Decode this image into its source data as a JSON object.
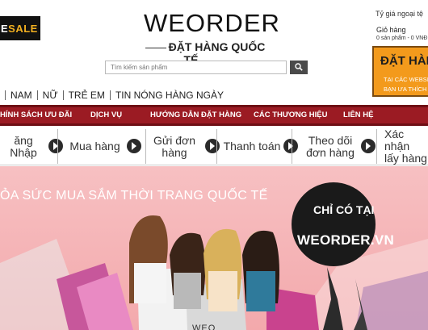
{
  "header": {
    "sale_logo_a": "E",
    "sale_logo_b": "SALE",
    "brand": "WEORDER",
    "tagline": "ĐẶT HÀNG QUỐC TẾ",
    "search_placeholder": "Tìm kiếm sản phẩm",
    "exchange_rate": "Tỷ giá ngoại tệ",
    "cart_title": "Giỏ hàng",
    "cart_info": "0 sản phẩm - 0 VNĐ",
    "promo_big": "ĐẶT HÀNG",
    "promo_line1": "TẠI CÁC WEBSITE",
    "promo_line2": "BẠN ƯA THÍCH"
  },
  "category_nav": [
    {
      "label": "NAM"
    },
    {
      "label": "NỮ"
    },
    {
      "label": "TRẺ EM"
    },
    {
      "label": "TIN NÓNG HÀNG NGÀY"
    }
  ],
  "main_menu": [
    {
      "label": "HÍNH SÁCH ƯU ĐÃI"
    },
    {
      "label": "DỊCH VỤ"
    },
    {
      "label": "HƯỚNG DẪN ĐẶT HÀNG"
    },
    {
      "label": "CÁC THƯƠNG HIỆU"
    },
    {
      "label": "LIÊN HỆ"
    }
  ],
  "steps": [
    {
      "line1": "ăng Nhập",
      "line2": ""
    },
    {
      "line1": "Mua hàng",
      "line2": ""
    },
    {
      "line1": "Gửi đơn",
      "line2": "hàng"
    },
    {
      "line1": "Thanh toán",
      "line2": ""
    },
    {
      "line1": "Theo dõi",
      "line2": "đơn hàng"
    },
    {
      "line1": "Xác nhận",
      "line2": "lấy hàng"
    }
  ],
  "banner": {
    "slogan": "ỎA SỨC MUA SẮM THỜI TRANG QUỐC TẾ",
    "badge_top": "CHỈ CÓ TẠI",
    "badge_main": "WEORDER.VN",
    "bag_text": "WEO"
  },
  "colors": {
    "menu_red": "#9b1b23",
    "promo_orange": "#f39a1c",
    "banner_pink": "#f5b4b7"
  }
}
